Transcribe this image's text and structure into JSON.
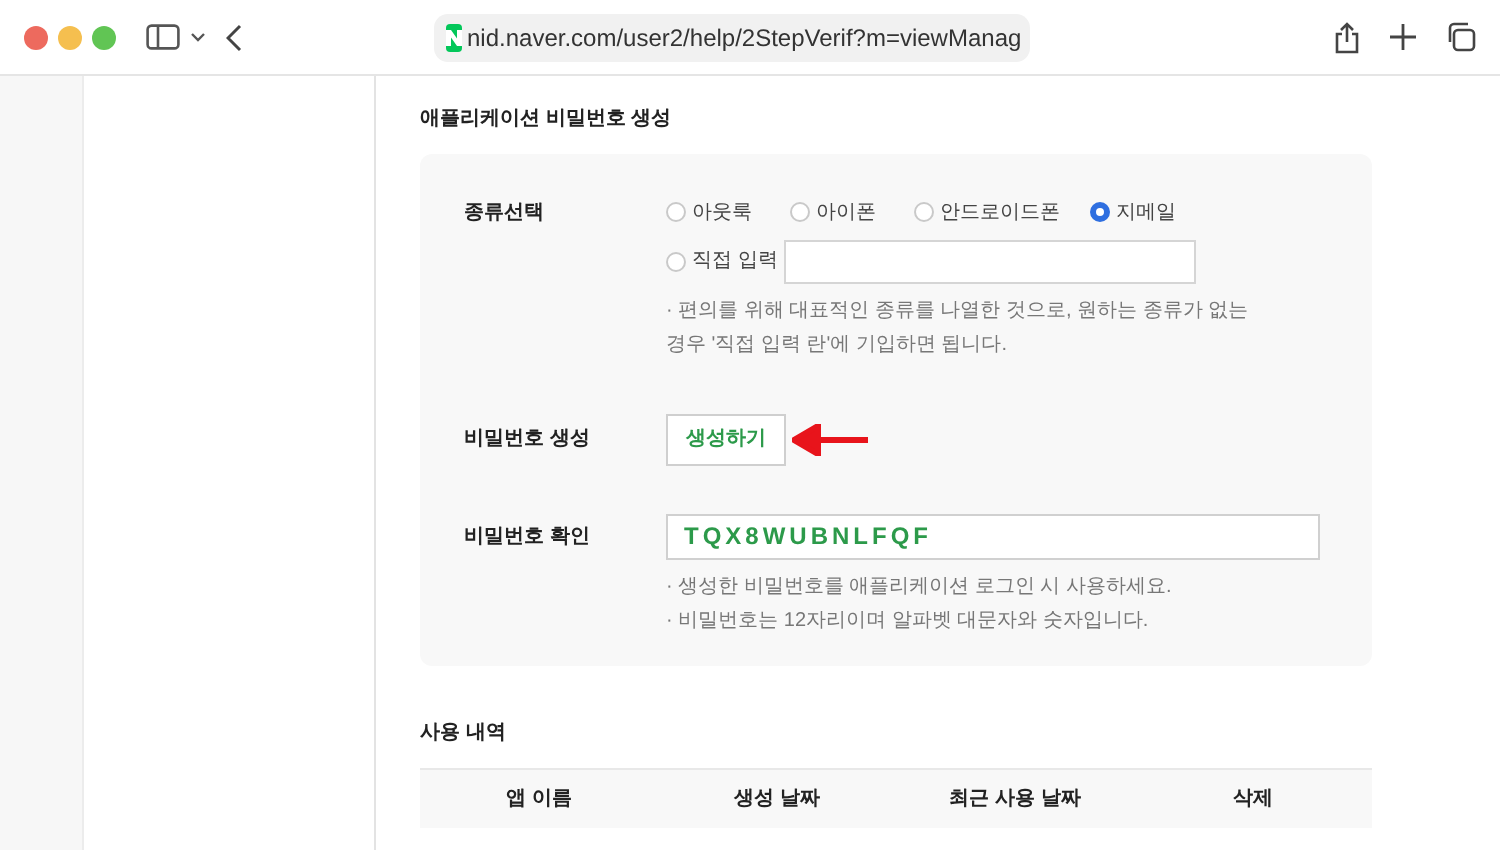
{
  "browser": {
    "url": "nid.naver.com/user2/help/2StepVerif?m=viewManag"
  },
  "section_title": "애플리케이션 비밀번호 생성",
  "type_select": {
    "label": "종류선택",
    "options": [
      {
        "label": "아웃룩",
        "selected": false
      },
      {
        "label": "아이폰",
        "selected": false
      },
      {
        "label": "안드로이드폰",
        "selected": false
      },
      {
        "label": "지메일",
        "selected": true
      }
    ],
    "custom": {
      "label": "직접 입력",
      "selected": false
    },
    "note": "· 편의를 위해 대표적인 종류를 나열한 것으로, 원하는 종류가 없는 경우 '직접 입력 란'에 기입하면 됩니다."
  },
  "generate": {
    "label": "비밀번호 생성",
    "button": "생성하기"
  },
  "confirm": {
    "label": "비밀번호 확인",
    "value": "TQX8WUBNLFQF",
    "notes": [
      "· 생성한 비밀번호를 애플리케이션 로그인 시 사용하세요.",
      "· 비밀번호는 12자리이며 알파벳 대문자와 숫자입니다."
    ]
  },
  "history": {
    "title": "사용 내역",
    "columns": [
      "앱 이름",
      "생성 날짜",
      "최근 사용 날짜",
      "삭제"
    ]
  }
}
